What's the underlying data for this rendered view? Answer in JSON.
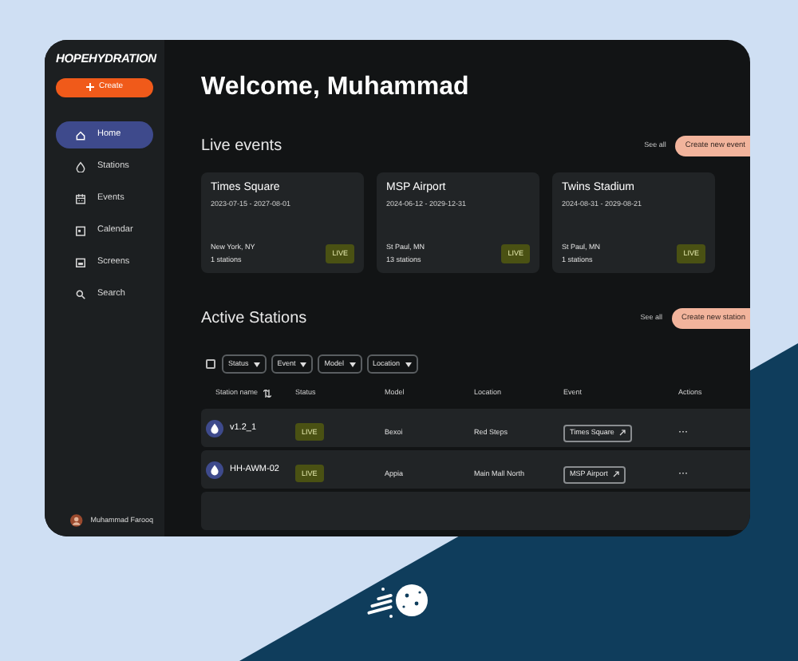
{
  "sidebar": {
    "logo": "HOPEHYDRATION",
    "create_button": "Create",
    "items": [
      {
        "label": "Home",
        "kind": "home",
        "selected": true
      },
      {
        "label": "Stations",
        "kind": "stations",
        "selected": false
      },
      {
        "label": "Events",
        "kind": "events",
        "selected": false
      },
      {
        "label": "Calendar",
        "kind": "calendar",
        "selected": false
      },
      {
        "label": "Screens",
        "kind": "screens",
        "selected": false
      },
      {
        "label": "Search",
        "kind": "search",
        "selected": false
      }
    ],
    "user": "Muhammad Farooq"
  },
  "heading": "Welcome, Muhammad",
  "live_events": {
    "title": "Live events",
    "see_all": "See all",
    "create_button": "Create new event",
    "cards": [
      {
        "name": "Times Square",
        "dates": "2023-07-15 - 2027-08-01",
        "location": "New York, NY",
        "stations": "1 stations",
        "status": "LIVE"
      },
      {
        "name": "MSP Airport",
        "dates": "2024-06-12 - 2029-12-31",
        "location": "St Paul, MN",
        "stations": "13 stations",
        "status": "LIVE"
      },
      {
        "name": "Twins Stadium",
        "dates": "2024-08-31 - 2029-08-21",
        "location": "St Paul, MN",
        "stations": "1 stations",
        "status": "LIVE"
      }
    ]
  },
  "active_stations": {
    "title": "Active Stations",
    "see_all": "See all",
    "create_button": "Create new station",
    "select_all_checked": false,
    "filters": [
      "Status",
      "Event",
      "Model",
      "Location"
    ],
    "columns": [
      "Station name",
      "Status",
      "Model",
      "Location",
      "Event",
      "Actions"
    ],
    "rows": [
      {
        "name": "v1.2_1",
        "status": "LIVE",
        "model": "Bexoi",
        "location": "Red Steps",
        "event": "Times Square",
        "actions": "···"
      },
      {
        "name": "HH-AWM-02",
        "status": "LIVE",
        "model": "Appia",
        "location": "Main Mall North",
        "event": "MSP Airport",
        "actions": "···"
      }
    ]
  }
}
